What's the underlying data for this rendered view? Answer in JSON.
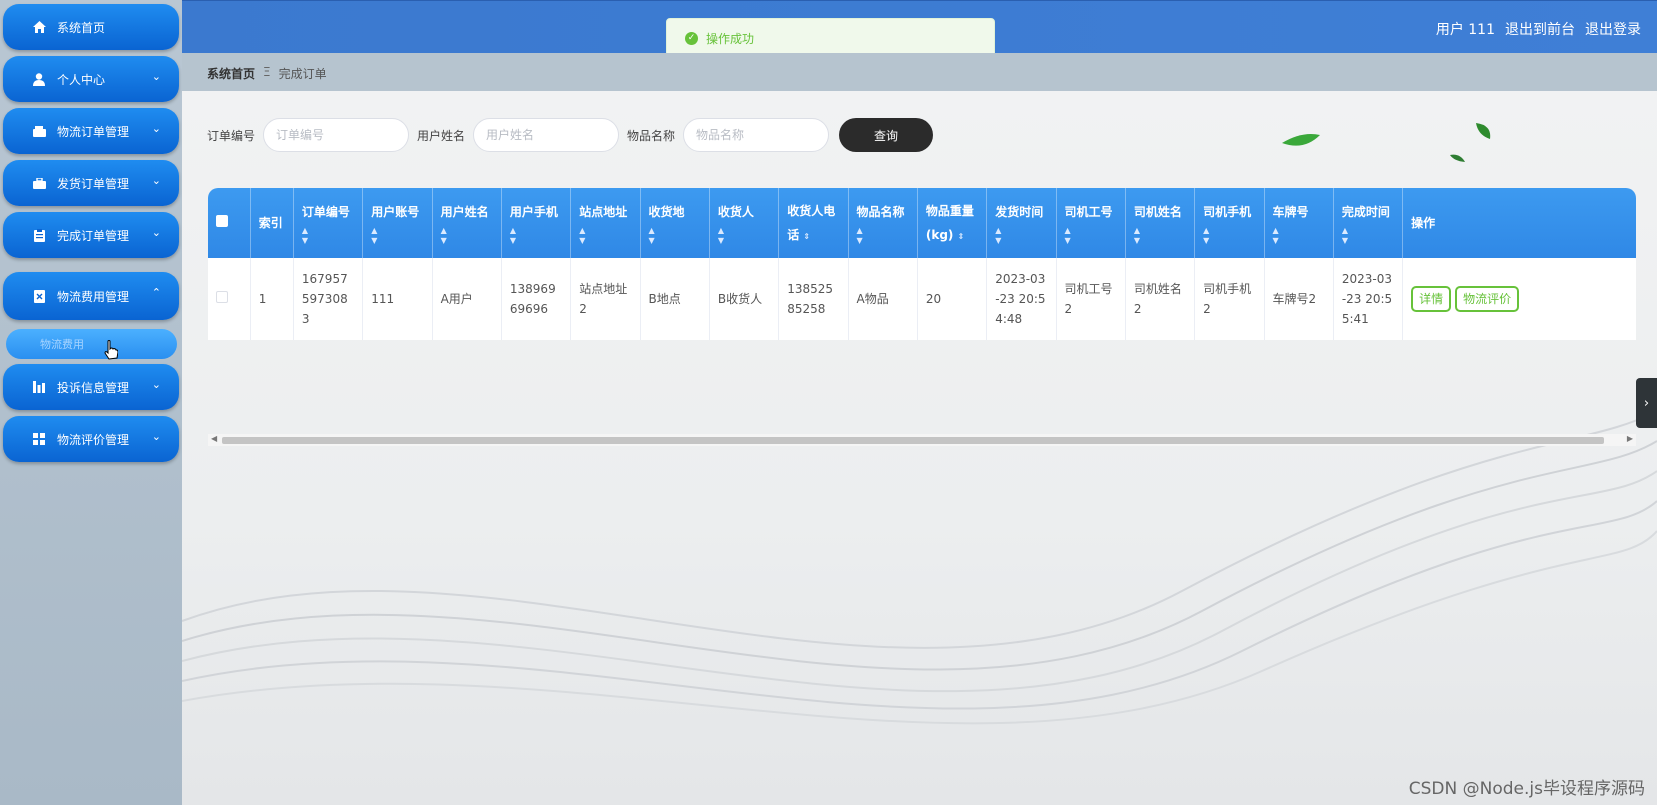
{
  "sidebar": {
    "items": [
      {
        "label": "系统首页",
        "icon": "home-icon",
        "arrow": ""
      },
      {
        "label": "个人中心",
        "icon": "user-icon",
        "arrow": "⌄"
      },
      {
        "label": "物流订单管理",
        "icon": "wallet-icon",
        "arrow": "⌄"
      },
      {
        "label": "发货订单管理",
        "icon": "briefcase-icon",
        "arrow": "⌄"
      },
      {
        "label": "完成订单管理",
        "icon": "clipboard-icon",
        "arrow": "⌄"
      },
      {
        "label": "物流费用管理",
        "icon": "receipt-icon",
        "arrow": "⌃"
      },
      {
        "label": "投诉信息管理",
        "icon": "chart-icon",
        "arrow": "⌄"
      },
      {
        "label": "物流评价管理",
        "icon": "grid-icon",
        "arrow": "⌄"
      }
    ],
    "submenu": {
      "label": "物流费用"
    }
  },
  "toast": {
    "message": "操作成功"
  },
  "header": {
    "user": "用户 111",
    "front": "退出到前台",
    "logout": "退出登录"
  },
  "breadcrumb": {
    "home": "系统首页",
    "sep": "Ξ",
    "current": "完成订单"
  },
  "search": {
    "order_label": "订单编号",
    "order_placeholder": "订单编号",
    "user_label": "用户姓名",
    "user_placeholder": "用户姓名",
    "item_label": "物品名称",
    "item_placeholder": "物品名称",
    "button": "查询"
  },
  "table": {
    "columns": [
      "索引",
      "订单编号",
      "用户账号",
      "用户姓名",
      "用户手机",
      "站点地址",
      "收货地",
      "收货人",
      "收货人电话",
      "物品名称",
      "物品重量(kg)",
      "发货时间",
      "司机工号",
      "司机姓名",
      "司机手机",
      "车牌号",
      "完成时间",
      "操作"
    ],
    "rows": [
      {
        "index": "1",
        "order_no": "1679575973083",
        "account": "111",
        "user_name": "A用户",
        "phone": "13896969696",
        "station": "站点地址2",
        "dest": "B地点",
        "receiver": "B收货人",
        "receiver_phone": "13852585258",
        "item": "A物品",
        "weight": "20",
        "ship_time": "2023-03-23 20:54:48",
        "driver_no": "司机工号2",
        "driver_name": "司机姓名2",
        "driver_phone": "司机手机2",
        "plate": "车牌号2",
        "done_time": "2023-03-23 20:55:41",
        "btn_detail": "详情",
        "btn_review": "物流评价"
      }
    ]
  },
  "watermark": "CSDN @Node.js毕设程序源码",
  "colors": {
    "primary": "#2f88e6",
    "success": "#67c23a",
    "dark_button": "#2b2b2b"
  }
}
